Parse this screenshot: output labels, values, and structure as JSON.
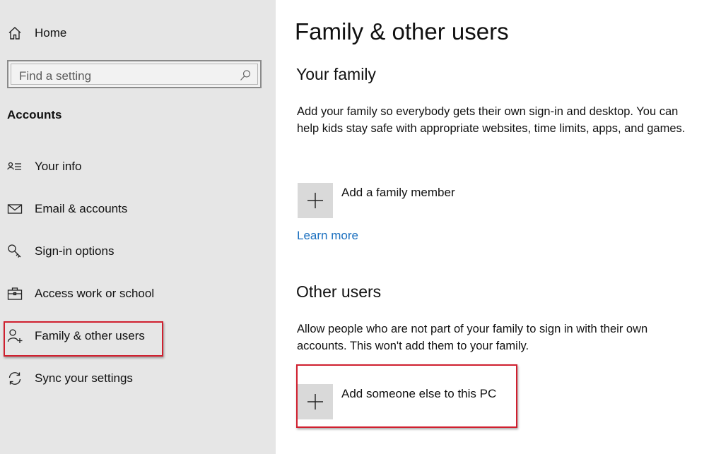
{
  "sidebar": {
    "home_label": "Home",
    "search": {
      "placeholder": "Find a setting",
      "value": ""
    },
    "section_title": "Accounts",
    "items": [
      {
        "label": "Your info",
        "icon": "your-info-icon"
      },
      {
        "label": "Email & accounts",
        "icon": "mail-icon"
      },
      {
        "label": "Sign-in options",
        "icon": "key-icon"
      },
      {
        "label": "Access work or school",
        "icon": "briefcase-icon"
      },
      {
        "label": "Family & other users",
        "icon": "person-add-icon",
        "selected": true
      },
      {
        "label": "Sync your settings",
        "icon": "sync-icon"
      }
    ]
  },
  "main": {
    "title": "Family & other users",
    "your_family": {
      "heading": "Your family",
      "description": "Add your family so everybody gets their own sign-in and desktop. You can help kids stay safe with appropriate websites, time limits, apps, and games.",
      "add_label": "Add a family member",
      "learn_more": "Learn more"
    },
    "other_users": {
      "heading": "Other users",
      "description": "Allow people who are not part of your family to sign in with their own accounts. This won't add them to your family.",
      "add_label": "Add someone else to this PC"
    }
  },
  "colors": {
    "sidebar_bg": "#e6e6e6",
    "highlight_border": "#d0202f",
    "link": "#1a6fbf",
    "add_tile": "#d9d9d9"
  }
}
